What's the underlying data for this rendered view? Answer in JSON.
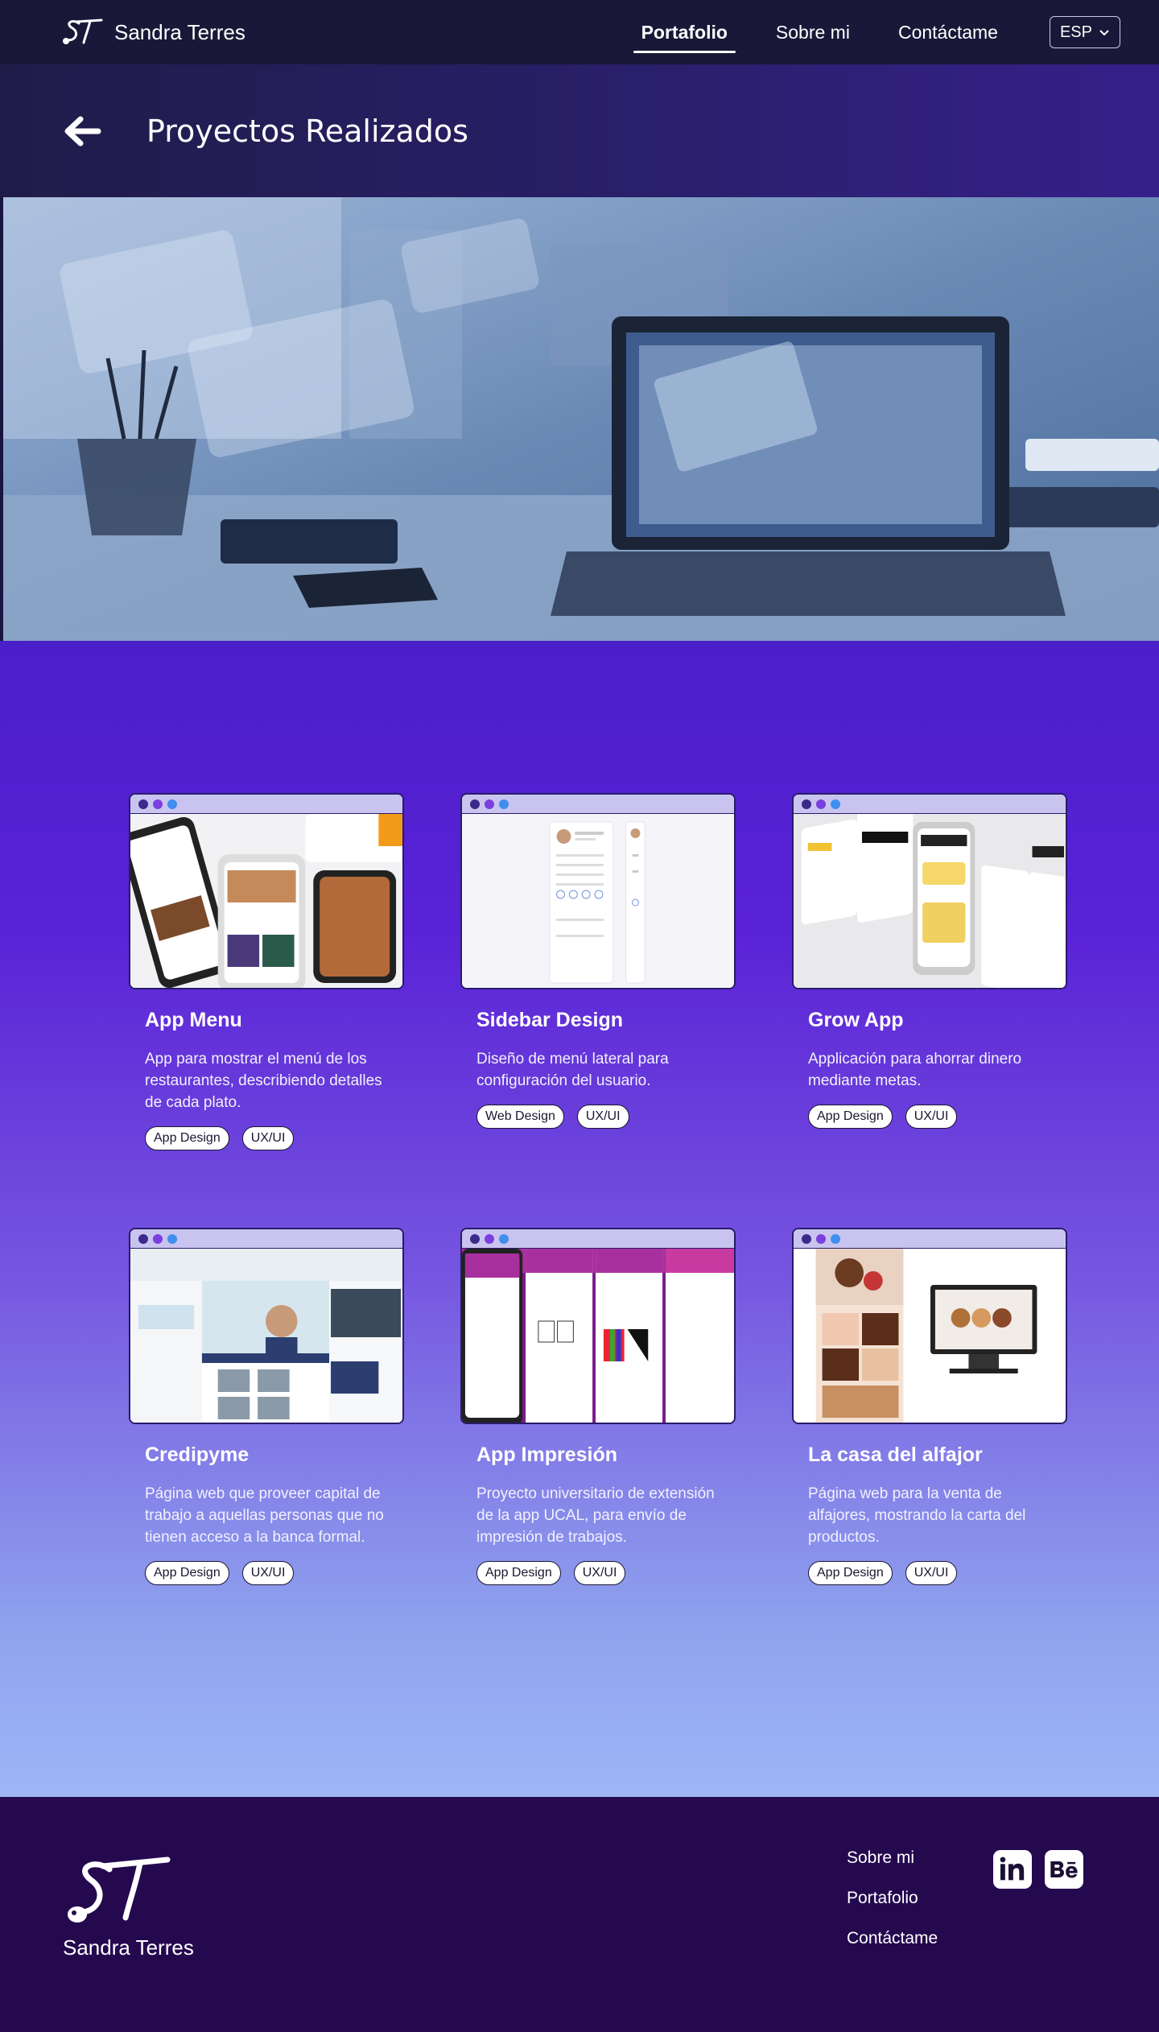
{
  "nav": {
    "brand": "Sandra Terres",
    "links": [
      "Portafolio",
      "Sobre mi",
      "Contáctame"
    ],
    "language": "ESP"
  },
  "header": {
    "title": "Proyectos Realizados"
  },
  "projects": [
    {
      "title": "App Menu",
      "description": "App para mostrar el menú de los restaurantes, describiendo detalles de cada plato.",
      "tags": [
        "App Design",
        "UX/UI"
      ]
    },
    {
      "title": "Sidebar Design",
      "description": "Diseño de menú lateral para configuración del usuario.",
      "tags": [
        "Web Design",
        "UX/UI"
      ]
    },
    {
      "title": "Grow App",
      "description": "Applicación para ahorrar dinero mediante metas.",
      "tags": [
        "App Design",
        "UX/UI"
      ]
    },
    {
      "title": "Credipyme",
      "description": "Página web que proveer capital de  trabajo a aquellas personas que no tienen acceso a la banca formal.",
      "tags": [
        "App Design",
        "UX/UI"
      ]
    },
    {
      "title": "App Impresión",
      "description": "Proyecto universitario de extensión de la app  UCAL, para envío de impresión de trabajos.",
      "tags": [
        "App Design",
        "UX/UI"
      ]
    },
    {
      "title": "La casa del alfajor",
      "description": "Página web para la venta de alfajores, mostrando la carta del productos.",
      "tags": [
        "App Design",
        "UX/UI"
      ]
    }
  ],
  "footer": {
    "name": "Sandra Terres",
    "links": [
      "Sobre mi",
      "Portafolio",
      "Contáctame"
    ],
    "social": [
      "linkedin-icon",
      "behance-icon"
    ]
  },
  "colors": {
    "nav_bg": "#191838",
    "main_gradient_top": "#4a1fc9",
    "main_gradient_bottom": "#9eb6f6",
    "footer_bg": "#25094f",
    "dot_1": "#3b2a8a",
    "dot_2": "#7b3fe0",
    "dot_3": "#3f8ef0"
  }
}
